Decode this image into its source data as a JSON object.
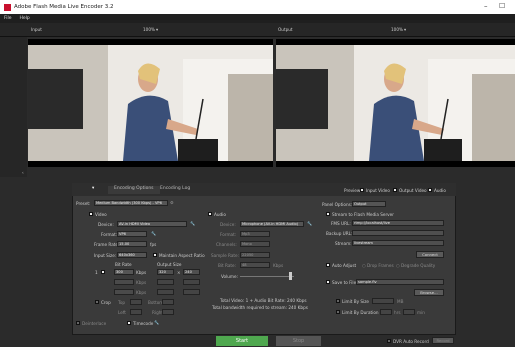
{
  "window": {
    "title": "Adobe Flash Media Live Encoder 3.2",
    "minimize": "–",
    "maximize": "☐"
  },
  "menu": [
    "File",
    "Help"
  ],
  "preview": {
    "input_label": "Input",
    "output_label": "Output",
    "input_zoom": "100%",
    "output_zoom": "100%"
  },
  "tabs": {
    "settings": "Encoding Options",
    "log": "Encoding Log"
  },
  "preview_opts": {
    "label": "Preview:",
    "input": "Input Video",
    "output": "Output Video",
    "audio": "Audio"
  },
  "preset": {
    "label": "Preset:",
    "value": "Medium Bandwidth (300 Kbps) - VP6"
  },
  "video": {
    "label": "Video",
    "device_label": "Device:",
    "device": "AV-in HDMI Video",
    "format_label": "Format:",
    "format": "VP6",
    "frame_rate_label": "Frame Rate:",
    "frame_rate": "15.00",
    "fps": "fps",
    "input_size_label": "Input Size:",
    "input_size": "640x360",
    "maintain_label": "Maintain Aspect Ratio",
    "bitrate_header": "Bit Rate",
    "output_size_header": "Output Size",
    "row1_index": "1",
    "row1_bitrate": "300",
    "row1_kbps": "Kbps",
    "row1_w": "320",
    "row1_x": "×",
    "row1_h": "240",
    "crop_label": "Crop",
    "deinterlace_label": "Deinterlace",
    "timecode_label": "Timecode",
    "top": "Top",
    "bottom": "Bottom",
    "left": "Left",
    "right": "Right",
    "kbps2": "Kbps",
    "kbps3": "Kbps"
  },
  "audio": {
    "label": "Audio",
    "device_label": "Device:",
    "device": "Microphone (AV-in HDMI Audio)",
    "format_label": "Format:",
    "format": "Mp3",
    "channels_label": "Channels:",
    "channels": "Mono",
    "sample_rate_label": "Sample Rate:",
    "sample_rate": "22050",
    "bitrate_label": "Bit Rate:",
    "bitrate": "48",
    "kbps": "Kbps",
    "volume_label": "Volume:"
  },
  "totals": {
    "line1": "Total Video: 1  +  Audio Bit Rate:  240 Kbps",
    "line2": "Total bandwidth required to stream:  240 Kbps"
  },
  "panel_options": {
    "label": "Panel Options:",
    "value": "Output"
  },
  "stream": {
    "label": "Stream to Flash Media Server",
    "fms_label": "FMS URL:",
    "fms_url": "rtmp://localhost/live",
    "backup_label": "Backup URL:",
    "stream_label": "Stream:",
    "stream_name": "livestream",
    "connect": "Connect"
  },
  "auto_adjust": {
    "label": "Auto Adjust",
    "drop_frames": "Drop Frames",
    "degrade": "Degrade Quality"
  },
  "save": {
    "label": "Save to File",
    "filename": "sample.flv",
    "browse": "Browse...",
    "limit_size_label": "Limit By Size",
    "size_unit": "MB",
    "limit_duration_label": "Limit By Duration",
    "hrs": "hrs",
    "min": "min"
  },
  "bottom": {
    "start": "Start",
    "stop": "Stop",
    "dvr": "DVR Auto Record",
    "record": "Record"
  }
}
